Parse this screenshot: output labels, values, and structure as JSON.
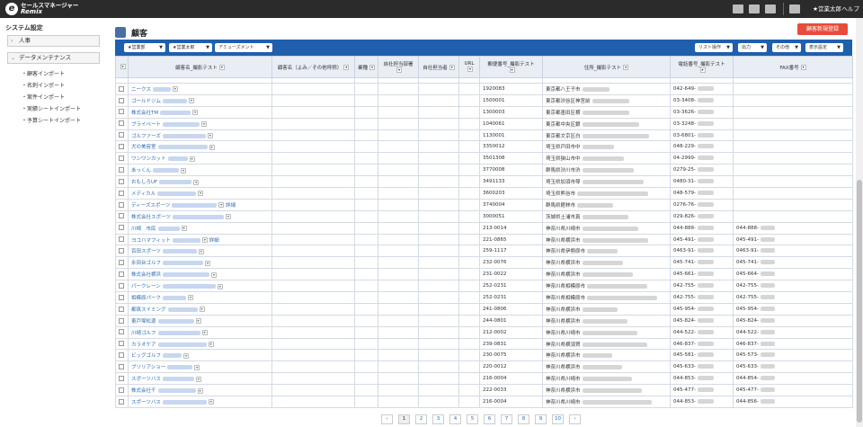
{
  "topbar": {
    "logo_mark": "e",
    "logo_line1": "セールスマネージャー",
    "logo_line2": "Remix",
    "user": "★営業太郎",
    "help": "ヘルプ"
  },
  "sidebar": {
    "title": "システム設定",
    "groups": [
      "人事",
      "データメンテナンス"
    ],
    "items": [
      "顧客インポート",
      "名刺インポート",
      "案件インポート",
      "実績シートインポート",
      "予算シートインポート"
    ]
  },
  "page": {
    "title": "顧客",
    "new_button": "顧客新規登録"
  },
  "toolbar": {
    "filters": [
      "★営業部",
      "★営業太郎",
      "アミューズメント"
    ],
    "actions": [
      "リスト操作",
      "出力",
      "その他",
      "表示設定"
    ]
  },
  "table": {
    "headers": [
      "顧客名_撮影テスト",
      "顧客名（よみ／その他呼称）",
      "業種",
      "自社担当部署",
      "自社担当者",
      "URL",
      "郵便番号_撮影テスト",
      "住所_撮影テスト",
      "電話番号_撮影テスト",
      "FAX番号"
    ],
    "detail_label": "詳細",
    "rows": [
      {
        "name": "ニークス",
        "postal": "1920083",
        "addr": "東京都八王子市",
        "tel": "042-649-",
        "fax": ""
      },
      {
        "name": "ゴールドジム",
        "postal": "1500001",
        "addr": "東京都渋谷区神宮前",
        "tel": "03-3408-",
        "fax": ""
      },
      {
        "name": "株式会社TM",
        "postal": "1300003",
        "addr": "東京都墨田区横",
        "tel": "03-3626-",
        "fax": ""
      },
      {
        "name": "プライベート",
        "postal": "1040061",
        "addr": "東京都中央区銀",
        "tel": "03-3248-",
        "fax": ""
      },
      {
        "name": "ゴルファーズ",
        "postal": "1130001",
        "addr": "東京都文京区白",
        "tel": "03-6801-",
        "fax": ""
      },
      {
        "name": "犬の美容室",
        "postal": "3350012",
        "addr": "埼玉県戸田市中",
        "tel": "048-229-",
        "fax": ""
      },
      {
        "name": "ワンワンカット",
        "postal": "3501308",
        "addr": "埼玉県狭山市中",
        "tel": "04-2999-",
        "fax": ""
      },
      {
        "name": "あっくん",
        "postal": "3770008",
        "addr": "群馬県渋川市渋",
        "tel": "0279-25-",
        "fax": ""
      },
      {
        "name": "おもしろUF",
        "postal": "3491133",
        "addr": "埼玉県加須市琴",
        "tel": "0480-31-",
        "fax": ""
      },
      {
        "name": "メディカル",
        "postal": "3600203",
        "addr": "埼玉県熊谷市",
        "tel": "048-579-",
        "fax": ""
      },
      {
        "name": "ディーズスポーツ",
        "postal": "3740004",
        "addr": "群馬県館林市",
        "tel": "0276-76-",
        "fax": ""
      },
      {
        "name": "株式会社スポーツ",
        "postal": "3000051",
        "addr": "茨城県土浦市真",
        "tel": "029-826-",
        "fax": ""
      },
      {
        "name": "川崎　市民",
        "postal": "213-0014",
        "addr": "神奈川県川崎市",
        "tel": "044-888-",
        "fax": "044-888-"
      },
      {
        "name": "ヨコハマフィット",
        "postal": "221-0865",
        "addr": "神奈川県横浜市",
        "tel": "045-491-",
        "fax": "045-491-"
      },
      {
        "name": "百田スポーツ",
        "postal": "259-1117",
        "addr": "神奈川県伊勢原市",
        "tel": "0463-91-",
        "fax": "0463-91-"
      },
      {
        "name": "永田台ゴルフ",
        "postal": "232-0076",
        "addr": "神奈川県横浜市",
        "tel": "045-741-",
        "fax": "045-741-"
      },
      {
        "name": "株式会社横浜",
        "postal": "231-0022",
        "addr": "神奈川県横浜市",
        "tel": "045-661-",
        "fax": "045-664-"
      },
      {
        "name": "パークレーン",
        "postal": "252-0231",
        "addr": "神奈川県相模原市",
        "tel": "042-755-",
        "fax": "042-755-"
      },
      {
        "name": "相模原パーク",
        "postal": "252-0231",
        "addr": "神奈川県相模原市",
        "tel": "042-755-",
        "fax": "042-755-"
      },
      {
        "name": "都筑スイミング",
        "postal": "241-0806",
        "addr": "神奈川県横浜市",
        "tel": "045-954-",
        "fax": "045-954-"
      },
      {
        "name": "東戸塚松源",
        "postal": "244-0801",
        "addr": "神奈川県横浜市",
        "tel": "045-824-",
        "fax": "045-824-"
      },
      {
        "name": "川崎ゴルフ",
        "postal": "212-0002",
        "addr": "神奈川県川崎市",
        "tel": "044-522-",
        "fax": "044-522-"
      },
      {
        "name": "カラオケア",
        "postal": "239-0831",
        "addr": "神奈川県横須賀",
        "tel": "046-837-",
        "fax": "046-837-"
      },
      {
        "name": "ビッグゴルフ",
        "postal": "230-0075",
        "addr": "神奈川県横浜市",
        "tel": "045-581-",
        "fax": "045-573-"
      },
      {
        "name": "ブリリアショー",
        "postal": "220-0012",
        "addr": "神奈川県横浜市",
        "tel": "045-633-",
        "fax": "045-633-"
      },
      {
        "name": "スポーツバス",
        "postal": "216-0004",
        "addr": "神奈川県川崎市",
        "tel": "044-853-",
        "fax": "044-854-"
      },
      {
        "name": "株式会社千",
        "postal": "222-0033",
        "addr": "神奈川県横浜市",
        "tel": "045-477-",
        "fax": "045-477-"
      },
      {
        "name": "スポーツバス",
        "postal": "216-0004",
        "addr": "神奈川県川崎市",
        "tel": "044-853-",
        "fax": "044-856-"
      }
    ]
  },
  "pagination": {
    "prev": "‹",
    "next": "›",
    "pages": [
      "1",
      "2",
      "3",
      "4",
      "5",
      "6",
      "7",
      "8",
      "9",
      "10"
    ],
    "current": "1"
  }
}
